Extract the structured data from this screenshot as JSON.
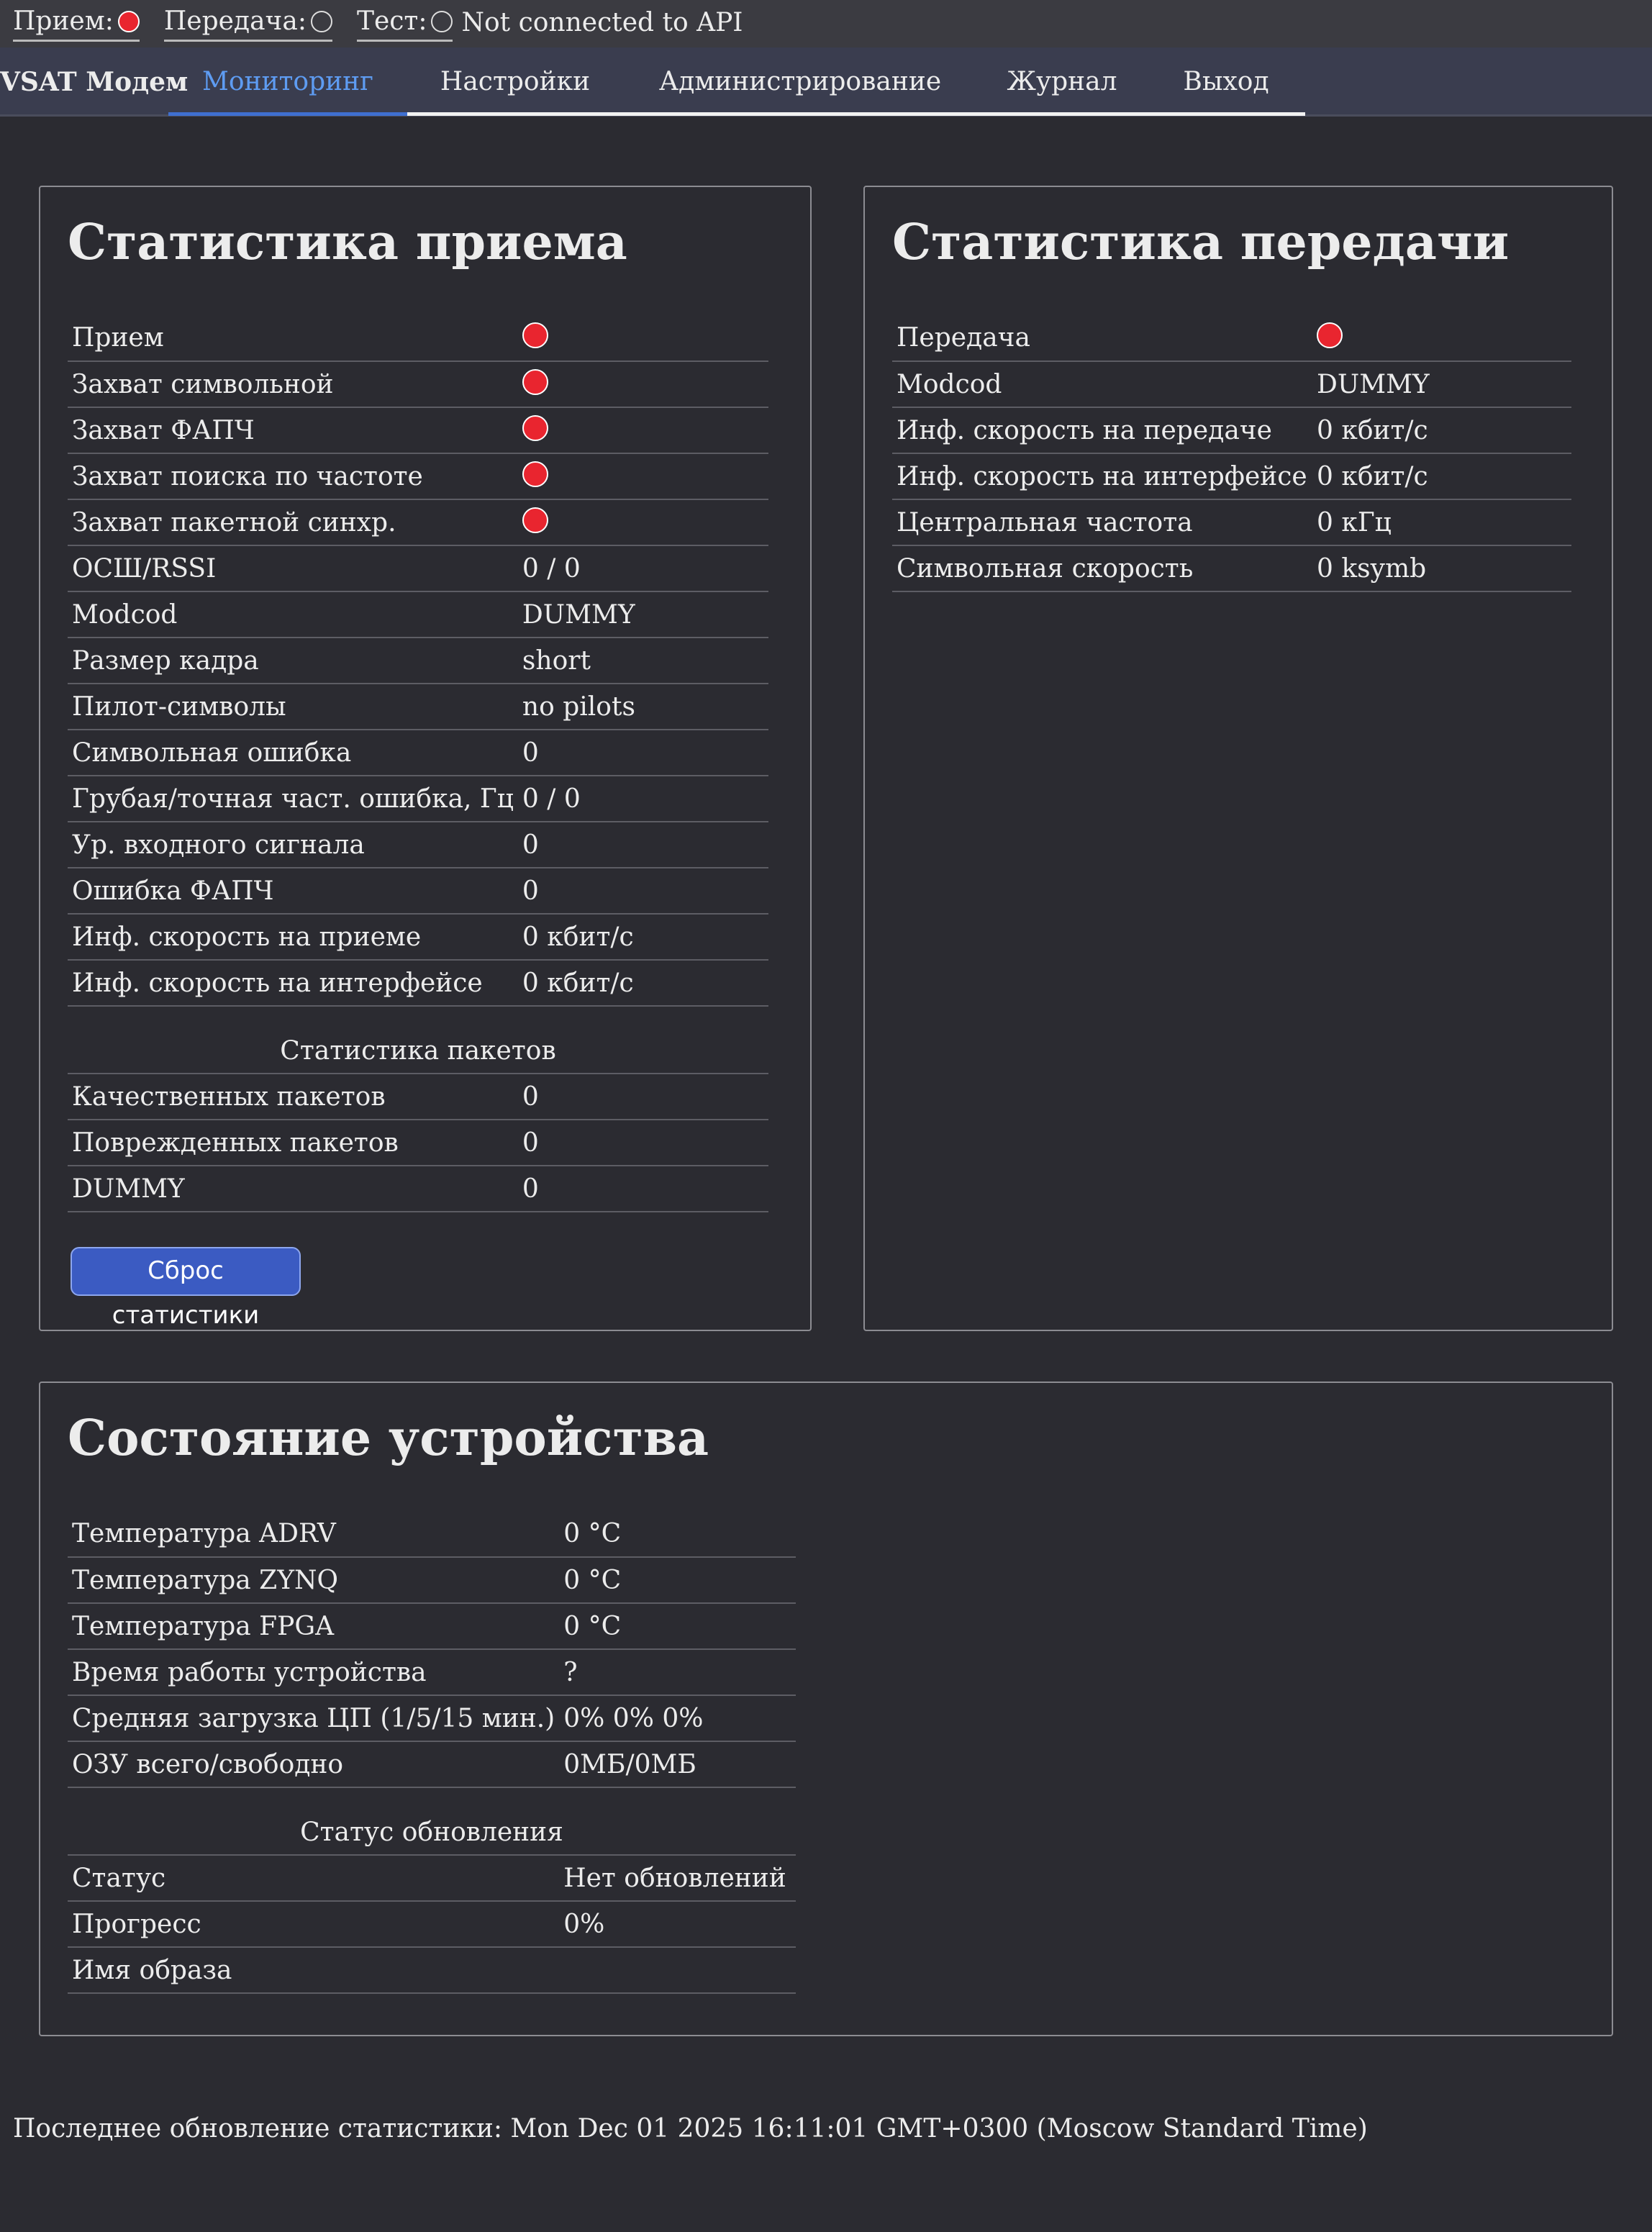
{
  "statusbar": {
    "rx_label": "Прием:",
    "tx_label": "Передача:",
    "test_label": "Тест:",
    "api_status": "Not connected to API"
  },
  "nav": {
    "brand": "VSAT Модем",
    "tabs": [
      {
        "label": "Мониторинг",
        "active": true
      },
      {
        "label": "Настройки",
        "active": false
      },
      {
        "label": "Администрирование",
        "active": false
      },
      {
        "label": "Журнал",
        "active": false
      },
      {
        "label": "Выход",
        "active": false
      }
    ]
  },
  "rx_stats": {
    "title": "Статистика приема",
    "rows": [
      {
        "label": "Прием",
        "indicator": "red"
      },
      {
        "label": "Захват символьной",
        "indicator": "red"
      },
      {
        "label": "Захват ФАПЧ",
        "indicator": "red"
      },
      {
        "label": "Захват поиска по частоте",
        "indicator": "red"
      },
      {
        "label": "Захват пакетной синхр.",
        "indicator": "red"
      },
      {
        "label": "ОСШ/RSSI",
        "value": "0 / 0"
      },
      {
        "label": "Modcod",
        "value": "DUMMY"
      },
      {
        "label": "Размер кадра",
        "value": "short"
      },
      {
        "label": "Пилот-символы",
        "value": "no pilots"
      },
      {
        "label": "Символьная ошибка",
        "value": "0"
      },
      {
        "label": "Грубая/точная част. ошибка, Гц",
        "value": "0 / 0"
      },
      {
        "label": "Ур. входного сигнала",
        "value": "0"
      },
      {
        "label": "Ошибка ФАПЧ",
        "value": "0"
      },
      {
        "label": "Инф. скорость на приеме",
        "value": "0 кбит/с"
      },
      {
        "label": "Инф. скорость на интерфейсе",
        "value": "0 кбит/с"
      }
    ],
    "packets_header": "Статистика пакетов",
    "packet_rows": [
      {
        "label": "Качественных пакетов",
        "value": "0"
      },
      {
        "label": "Поврежденных пакетов",
        "value": "0"
      },
      {
        "label": "DUMMY",
        "value": "0"
      }
    ],
    "reset_button": "Сброс статистики"
  },
  "tx_stats": {
    "title": "Статистика передачи",
    "rows": [
      {
        "label": "Передача",
        "indicator": "red"
      },
      {
        "label": "Modcod",
        "value": "DUMMY"
      },
      {
        "label": "Инф. скорость на передаче",
        "value": "0 кбит/с"
      },
      {
        "label": "Инф. скорость на интерфейсе",
        "value": "0 кбит/с"
      },
      {
        "label": "Центральная частота",
        "value": "0 кГц"
      },
      {
        "label": "Символьная скорость",
        "value": "0 ksymb"
      }
    ]
  },
  "device": {
    "title": "Состояние устройства",
    "rows": [
      {
        "label": "Температура ADRV",
        "value": "0 °C"
      },
      {
        "label": "Температура ZYNQ",
        "value": "0 °C"
      },
      {
        "label": "Температура FPGA",
        "value": "0 °C"
      },
      {
        "label": "Время работы устройства",
        "value": "?"
      },
      {
        "label": "Средняя загрузка ЦП (1/5/15 мин.)",
        "value": "0% 0% 0%"
      },
      {
        "label": "ОЗУ всего/свободно",
        "value": "0МБ/0МБ"
      }
    ],
    "update_header": "Статус обновления",
    "update_rows": [
      {
        "label": "Статус",
        "value": "Нет обновлений"
      },
      {
        "label": "Прогресс",
        "value": "0%"
      },
      {
        "label": "Имя образа",
        "value": ""
      }
    ]
  },
  "footer": {
    "text": "Последнее обновление статистики: Mon Dec 01 2025 16:11:01 GMT+0300 (Moscow Standard Time)"
  },
  "colors": {
    "background": "#2b2b31",
    "active_tab": "#5e9cf2",
    "indicator_on": "#e9252f",
    "button": "#3b5bc2"
  }
}
